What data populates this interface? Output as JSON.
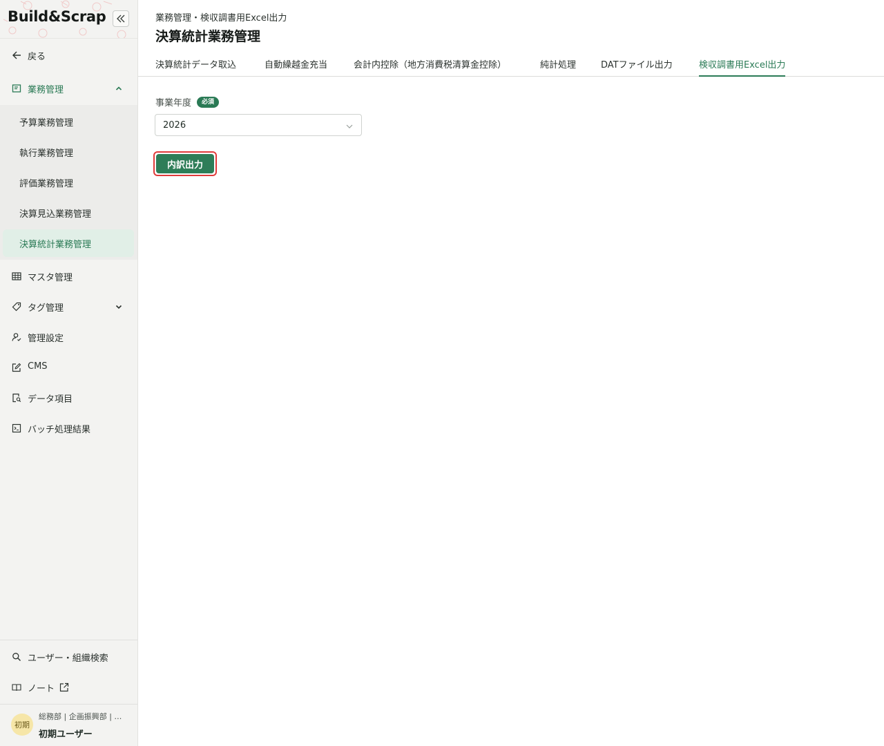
{
  "app": {
    "logo_text": "Build&Scrap",
    "collapse_icon": "double-chevron-left-icon"
  },
  "sidebar": {
    "back_label": "戻る",
    "section": {
      "label": "業務管理",
      "expanded": true,
      "items": [
        {
          "label": "予算業務管理",
          "active": false
        },
        {
          "label": "執行業務管理",
          "active": false
        },
        {
          "label": "評価業務管理",
          "active": false
        },
        {
          "label": "決算見込業務管理",
          "active": false
        },
        {
          "label": "決算統計業務管理",
          "active": true
        }
      ]
    },
    "items": [
      {
        "label": "マスタ管理",
        "icon": "table-icon"
      },
      {
        "label": "タグ管理",
        "icon": "tag-icon"
      },
      {
        "label": "管理設定",
        "icon": "user-settings-icon"
      },
      {
        "label": "CMS",
        "icon": "edit-icon"
      },
      {
        "label": "データ項目",
        "icon": "document-search-icon"
      },
      {
        "label": "バッチ処理結果",
        "icon": "terminal-icon"
      }
    ],
    "bottom_items": [
      {
        "label": "ユーザー・組織検索",
        "icon": "search-icon"
      },
      {
        "label": "ノート",
        "icon": "book-icon"
      }
    ],
    "user": {
      "avatar_text": "初期",
      "org": "総務部 | 企画振興部 | …",
      "name": "初期ユーザー"
    }
  },
  "header": {
    "breadcrumb": "業務管理・検収調書用Excel出力",
    "title": "決算統計業務管理"
  },
  "tabs": [
    {
      "label": "決算統計データ取込",
      "active": false
    },
    {
      "label": "自動繰越金充当",
      "active": false
    },
    {
      "label": "会計内控除（地方消費税清算金控除）",
      "active": false
    },
    {
      "label": "純計処理",
      "active": false
    },
    {
      "label": "DATファイル出力",
      "active": false
    },
    {
      "label": "検収調書用Excel出力",
      "active": true
    }
  ],
  "form": {
    "year_label": "事業年度",
    "required_badge": "必須",
    "year_value": "2026",
    "export_button": "内訳出力"
  },
  "colors": {
    "accent": "#2a7a55",
    "sidebar_bg": "#f3f3f1",
    "active_item_bg": "#e1efe7",
    "highlight_border": "#e03a3a"
  }
}
